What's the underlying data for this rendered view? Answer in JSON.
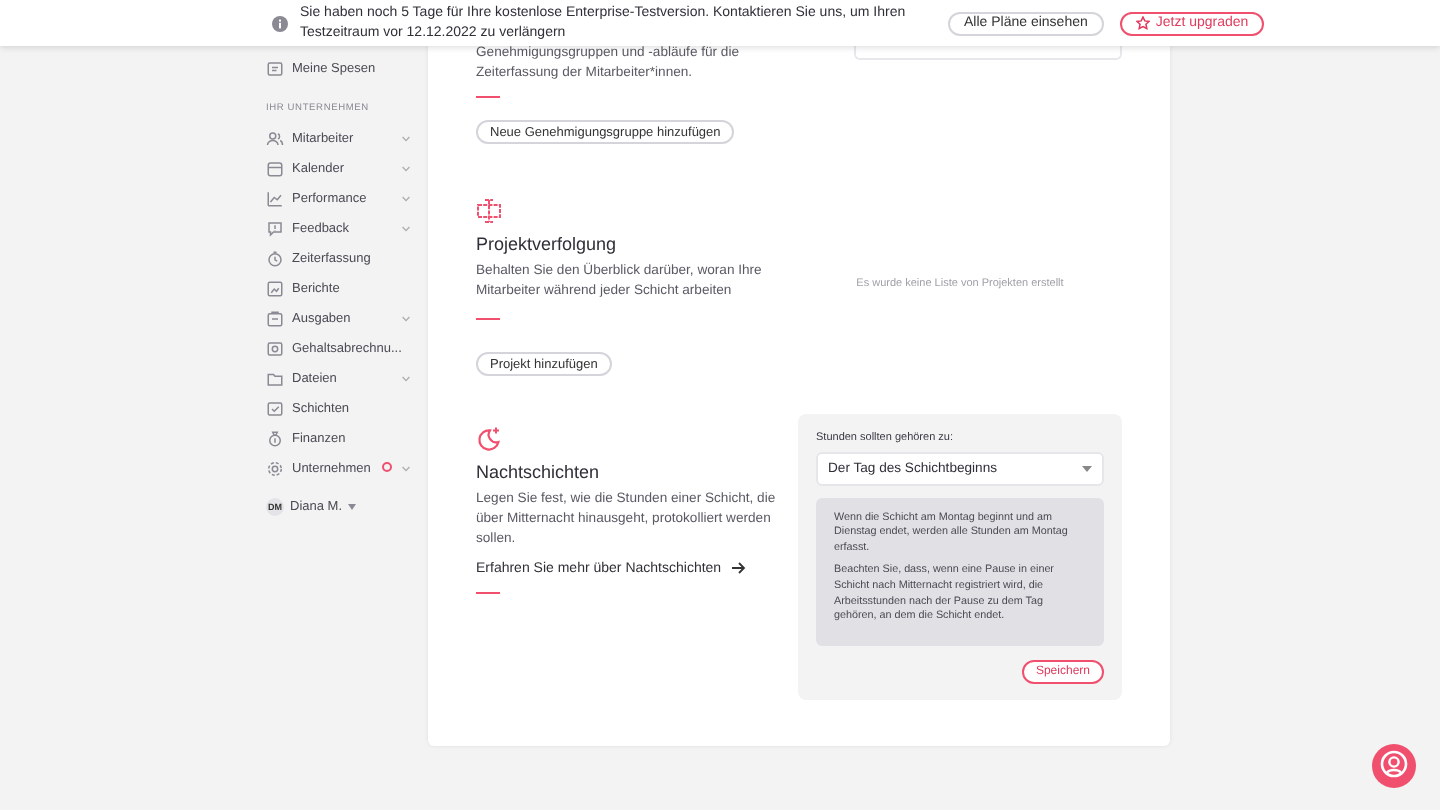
{
  "banner": {
    "message": "Sie haben noch 5 Tage für Ihre kostenlose Enterprise-Testversion. Kontaktieren Sie uns, um Ihren Testzeitraum vor 12.12.2022 zu verlängern",
    "buttons": [
      {
        "label": "Alle Pläne einsehen",
        "kind": "secondary"
      },
      {
        "label": "Jetzt upgraden",
        "kind": "upgrade"
      }
    ]
  },
  "sidebar": {
    "personal_items": [
      {
        "label": "Meine Spesen",
        "expandable": false,
        "alert": false
      }
    ],
    "section_heading": "IHR UNTERNEHMEN",
    "company_items": [
      {
        "label": "Mitarbeiter",
        "expandable": true,
        "alert": false
      },
      {
        "label": "Kalender",
        "expandable": true,
        "alert": false
      },
      {
        "label": "Performance",
        "expandable": true,
        "alert": false
      },
      {
        "label": "Feedback",
        "expandable": true,
        "alert": false
      },
      {
        "label": "Zeiterfassung",
        "expandable": false,
        "alert": false
      },
      {
        "label": "Berichte",
        "expandable": false,
        "alert": false
      },
      {
        "label": "Ausgaben",
        "expandable": true,
        "alert": false
      },
      {
        "label": "Gehaltsabrechnu...",
        "expandable": false,
        "alert": false
      },
      {
        "label": "Dateien",
        "expandable": true,
        "alert": false
      },
      {
        "label": "Schichten",
        "expandable": false,
        "alert": false
      },
      {
        "label": "Finanzen",
        "expandable": false,
        "alert": false
      },
      {
        "label": "Unternehmen",
        "expandable": true,
        "alert": true
      }
    ],
    "user": {
      "initials": "DM",
      "name": "Diana M."
    }
  },
  "sections": [
    {
      "kind": "approval",
      "description": "Genehmigungsgruppen und -abläufe für die Zeiterfassung der Mitarbeiter*innen.",
      "button": "Neue Genehmigungsgruppe hinzufügen"
    },
    {
      "kind": "projects",
      "title": "Projektverfolgung",
      "description": "Behalten Sie den Überblick darüber, woran Ihre Mitarbeiter während jeder Schicht arbeiten",
      "button": "Projekt hinzufügen",
      "empty_text": "Es wurde keine Liste von Projekten erstellt"
    },
    {
      "kind": "night",
      "title": "Nachtschichten",
      "description": "Legen Sie fest, wie die Stunden einer Schicht, die über Mitternacht hinausgeht, protokolliert werden sollen.",
      "link": "Erfahren Sie mehr über Nachtschichten",
      "settings": {
        "label": "Stunden sollten gehören zu:",
        "select_value": "Der Tag des Schichtbeginns",
        "info": [
          "Wenn die Schicht am Montag beginnt und am Dienstag endet, werden alle Stunden am Montag erfasst.",
          "Beachten Sie, dass, wenn eine Pause in einer Schicht nach Mitternacht registriert wird, die Arbeitsstunden nach der Pause zu dem Tag gehören, an dem die Schicht endet."
        ],
        "save_button": "Speichern"
      }
    }
  ]
}
